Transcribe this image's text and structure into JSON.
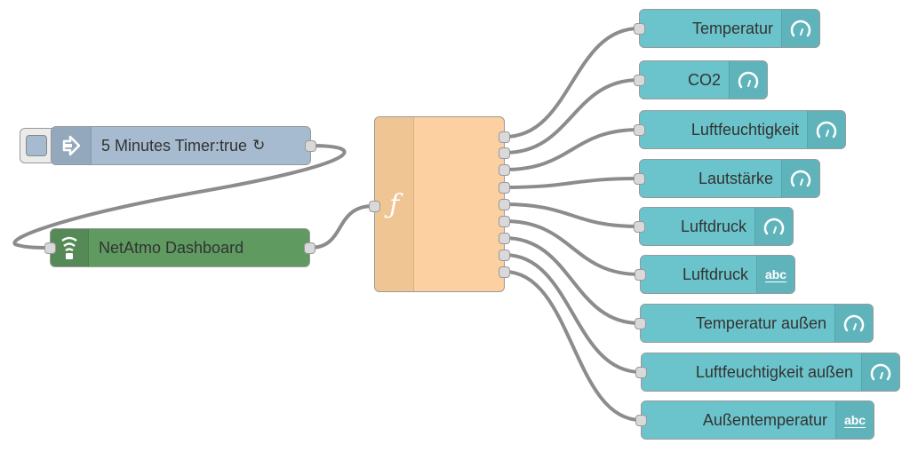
{
  "flow": {
    "inject": {
      "label": "5 Minutes Timer:true",
      "repeat_symbol": "↻",
      "icon": "arrow-in-icon",
      "color": "#a6bbcf"
    },
    "websocket": {
      "label": "NetAtmo Dashboard",
      "icon": "wifi-icon",
      "color": "#5f9a60"
    },
    "function": {
      "icon_glyph": "ƒ",
      "color": "#fdd0a2",
      "outputs": 9
    },
    "outputs": [
      {
        "label": "Temperatur",
        "icon": "gauge-icon"
      },
      {
        "label": "CO2",
        "icon": "gauge-icon"
      },
      {
        "label": "Luftfeuchtigkeit",
        "icon": "gauge-icon"
      },
      {
        "label": "Lautstärke",
        "icon": "gauge-icon"
      },
      {
        "label": "Luftdruck",
        "icon": "gauge-icon"
      },
      {
        "label": "Luftdruck",
        "icon": "text-icon",
        "icon_text": "abc"
      },
      {
        "label": "Temperatur außen",
        "icon": "gauge-icon"
      },
      {
        "label": "Luftfeuchtigkeit außen",
        "icon": "gauge-icon"
      },
      {
        "label": "Außentemperatur",
        "icon": "text-icon",
        "icon_text": "abc"
      }
    ],
    "ui_node_color": "#6bc4cb",
    "wire_color": "#8c8c8c"
  }
}
